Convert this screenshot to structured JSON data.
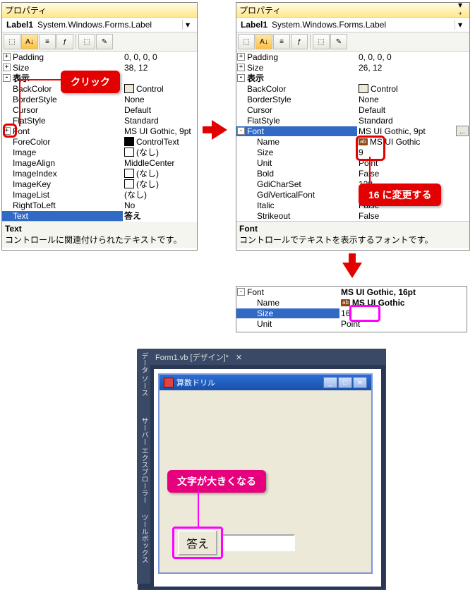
{
  "panelTitle": "プロパティ",
  "comboName": "Label1",
  "comboType": "System.Windows.Forms.Label",
  "left": {
    "rows": [
      {
        "exp": "+",
        "k": "Padding",
        "v": "0, 0, 0, 0"
      },
      {
        "exp": "+",
        "k": "Size",
        "v": "38, 12"
      },
      {
        "exp": "-",
        "k": "表示",
        "header": true
      },
      {
        "indent": 1,
        "k": "BackColor",
        "sw": "#ece9d8",
        "v": "Control"
      },
      {
        "indent": 1,
        "k": "BorderStyle",
        "v": "None"
      },
      {
        "indent": 1,
        "k": "Cursor",
        "v": "Default"
      },
      {
        "indent": 1,
        "k": "FlatStyle",
        "v": "Standard"
      },
      {
        "exp": "+",
        "indent": 0,
        "k": "Font",
        "v": "MS UI Gothic, 9pt"
      },
      {
        "indent": 1,
        "k": "ForeColor",
        "sw": "#000",
        "v": "ControlText"
      },
      {
        "indent": 1,
        "k": "Image",
        "sw": "#fff",
        "v": "(なし)"
      },
      {
        "indent": 1,
        "k": "ImageAlign",
        "v": "MiddleCenter"
      },
      {
        "indent": 1,
        "k": "ImageIndex",
        "sw": "#fff",
        "v": "(なし)"
      },
      {
        "indent": 1,
        "k": "ImageKey",
        "sw": "#fff",
        "v": "(なし)"
      },
      {
        "indent": 1,
        "k": "ImageList",
        "v": "(なし)"
      },
      {
        "indent": 1,
        "k": "RightToLeft",
        "v": "No"
      },
      {
        "indent": 1,
        "k": "Text",
        "v": "答え",
        "sel": true,
        "bold": true
      }
    ],
    "helpTitle": "Text",
    "helpText": "コントロールに関連付けられたテキストです。"
  },
  "right": {
    "rows": [
      {
        "exp": "+",
        "k": "Padding",
        "v": "0, 0, 0, 0"
      },
      {
        "exp": "+",
        "k": "Size",
        "v": "26, 12"
      },
      {
        "exp": "-",
        "k": "表示",
        "header": true
      },
      {
        "indent": 1,
        "k": "BackColor",
        "sw": "#ece9d8",
        "v": "Control"
      },
      {
        "indent": 1,
        "k": "BorderStyle",
        "v": "None"
      },
      {
        "indent": 1,
        "k": "Cursor",
        "v": "Default"
      },
      {
        "indent": 1,
        "k": "FlatStyle",
        "v": "Standard"
      },
      {
        "exp": "-",
        "k": "Font",
        "v": "MS UI Gothic, 9pt",
        "sel": true,
        "ell": true
      },
      {
        "indent": 2,
        "k": "Name",
        "abc": true,
        "v": "MS UI Gothic"
      },
      {
        "indent": 2,
        "k": "Size",
        "v": "9"
      },
      {
        "indent": 2,
        "k": "Unit",
        "v": "Point"
      },
      {
        "indent": 2,
        "k": "Bold",
        "v": "False"
      },
      {
        "indent": 2,
        "k": "GdiCharSet",
        "v": "128"
      },
      {
        "indent": 2,
        "k": "GdiVerticalFont",
        "v": "False"
      },
      {
        "indent": 2,
        "k": "Italic",
        "v": "False"
      },
      {
        "indent": 2,
        "k": "Strikeout",
        "v": "False"
      }
    ],
    "helpTitle": "Font",
    "helpText": "コントロールでテキストを表示するフォントです。"
  },
  "snippet": {
    "rows": [
      {
        "exp": "-",
        "k": "Font",
        "v": "MS UI Gothic, 16pt",
        "bold": true
      },
      {
        "indent": 2,
        "k": "Name",
        "abc": true,
        "v": "MS UI Gothic",
        "bold": true
      },
      {
        "indent": 2,
        "k": "Size",
        "v": "16",
        "sel": true
      },
      {
        "indent": 2,
        "k": "Unit",
        "v": "Point"
      }
    ]
  },
  "callouts": {
    "click": "クリック",
    "change16": "16 に変更する",
    "bigger": "文字が大きくなる"
  },
  "designer": {
    "tab": "Form1.vb [デザイン]*",
    "formTitle": "算数ドリル",
    "btn": "答え",
    "vtabs": [
      "データ ソース",
      "サーバー エクスプローラー",
      "ツールボックス"
    ]
  },
  "toolbarIcons": [
    "⬚",
    "A↓",
    "≡",
    "ƒ",
    "|",
    "⬚",
    "✎"
  ]
}
